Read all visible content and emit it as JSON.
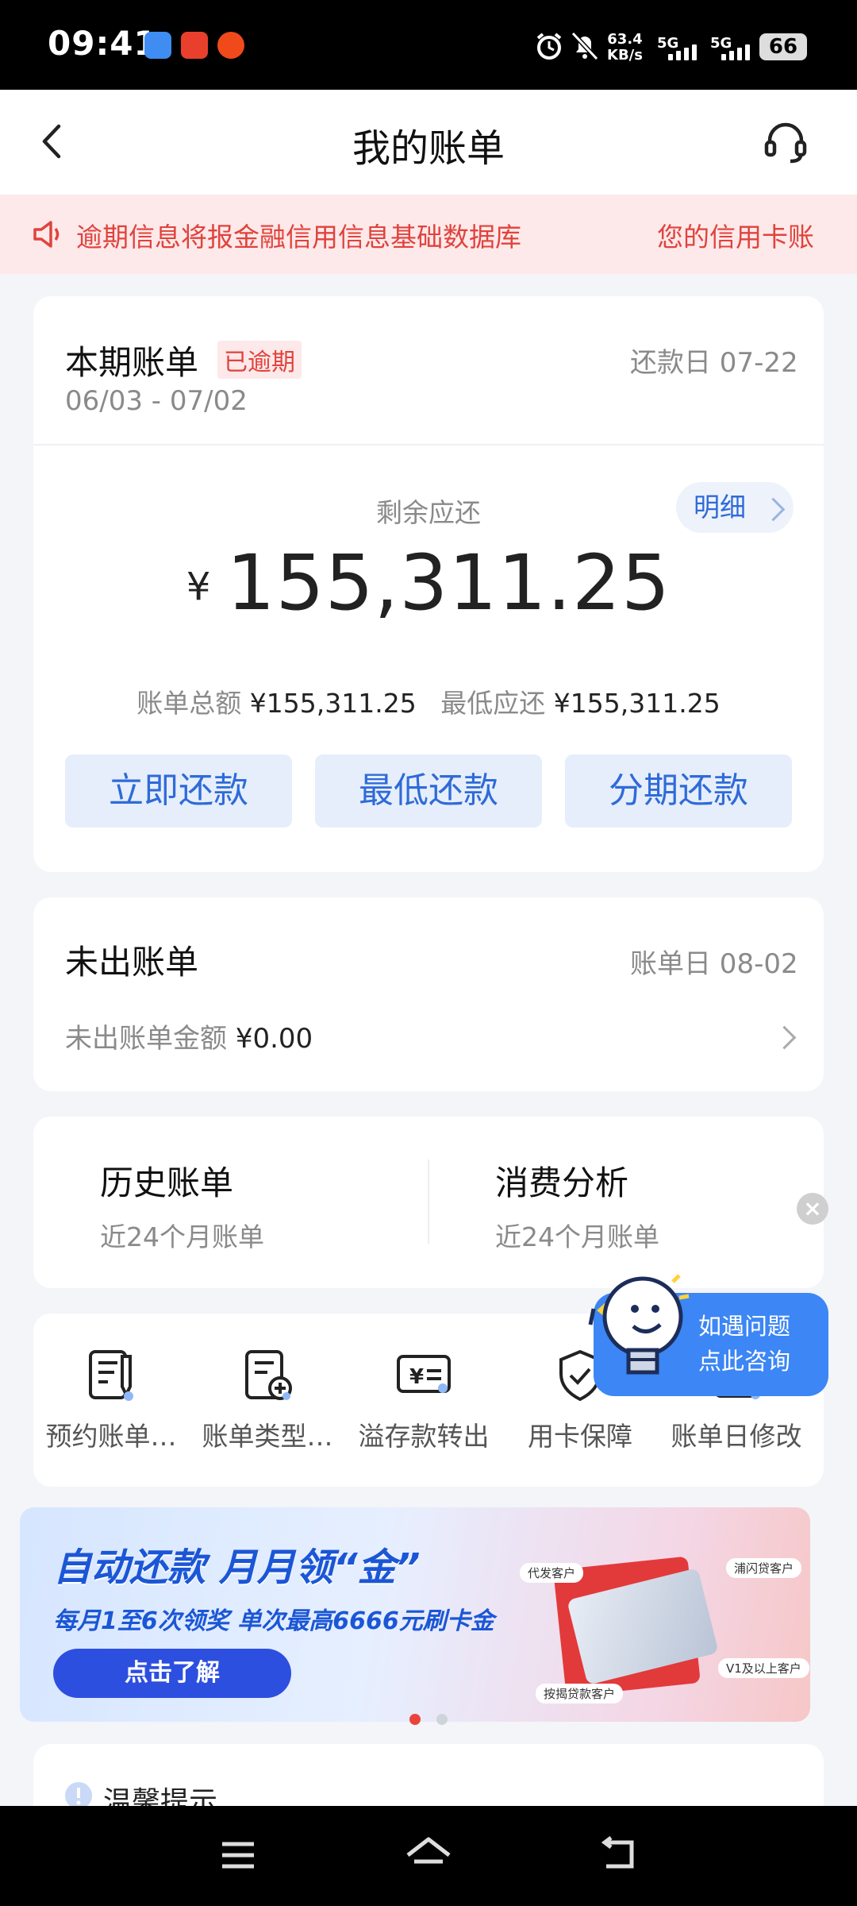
{
  "status": {
    "time": "09:41",
    "net_speed_value": "63.4",
    "net_speed_unit": "KB/s",
    "sim1": "5G",
    "sim2": "5G",
    "battery": "66"
  },
  "header": {
    "title": "我的账单",
    "back_icon": "chevron-left-icon",
    "support_icon": "headset-icon"
  },
  "notice": {
    "text1": "逾期信息将报金融信用信息基础数据库",
    "text2": "您的信用卡账"
  },
  "current_bill": {
    "title": "本期账单",
    "status_tag": "已逾期",
    "due_label": "还款日 07-22",
    "period": "06/03 - 07/02",
    "remaining_label": "剩余应还",
    "detail_label": "明细",
    "currency": "¥",
    "remaining_amount": "155,311.25",
    "total_label": "账单总额",
    "total_value": "¥155,311.25",
    "min_label": "最低应还",
    "min_value": "¥155,311.25",
    "actions": [
      "立即还款",
      "最低还款",
      "分期还款"
    ]
  },
  "unbilled": {
    "title": "未出账单",
    "bill_day": "账单日 08-02",
    "amount_label": "未出账单金额",
    "amount_value": "¥0.00"
  },
  "links": [
    {
      "title": "历史账单",
      "sub": "近24个月账单"
    },
    {
      "title": "消费分析",
      "sub": "近24个月账单"
    }
  ],
  "tools": [
    {
      "label": "预约账单…",
      "icon": "bill-edit-icon"
    },
    {
      "label": "账单类型…",
      "icon": "bill-add-icon"
    },
    {
      "label": "溢存款转出",
      "icon": "yuan-transfer-icon"
    },
    {
      "label": "用卡保障",
      "icon": "shield-check-icon"
    },
    {
      "label": "账单日修改",
      "icon": "bill-date-edit-icon"
    }
  ],
  "consult": {
    "line1": "如遇问题",
    "line2": "点此咨询"
  },
  "banner": {
    "title": "自动还款 月月领“金”",
    "subtitle": "每月1至6次领奖 单次最高6666元刷卡金",
    "button": "点击了解",
    "badges": [
      "代发客户",
      "浦闪贷客户",
      "按揭贷款客户",
      "V1及以上客户"
    ]
  },
  "tips": {
    "title": "温馨提示"
  }
}
